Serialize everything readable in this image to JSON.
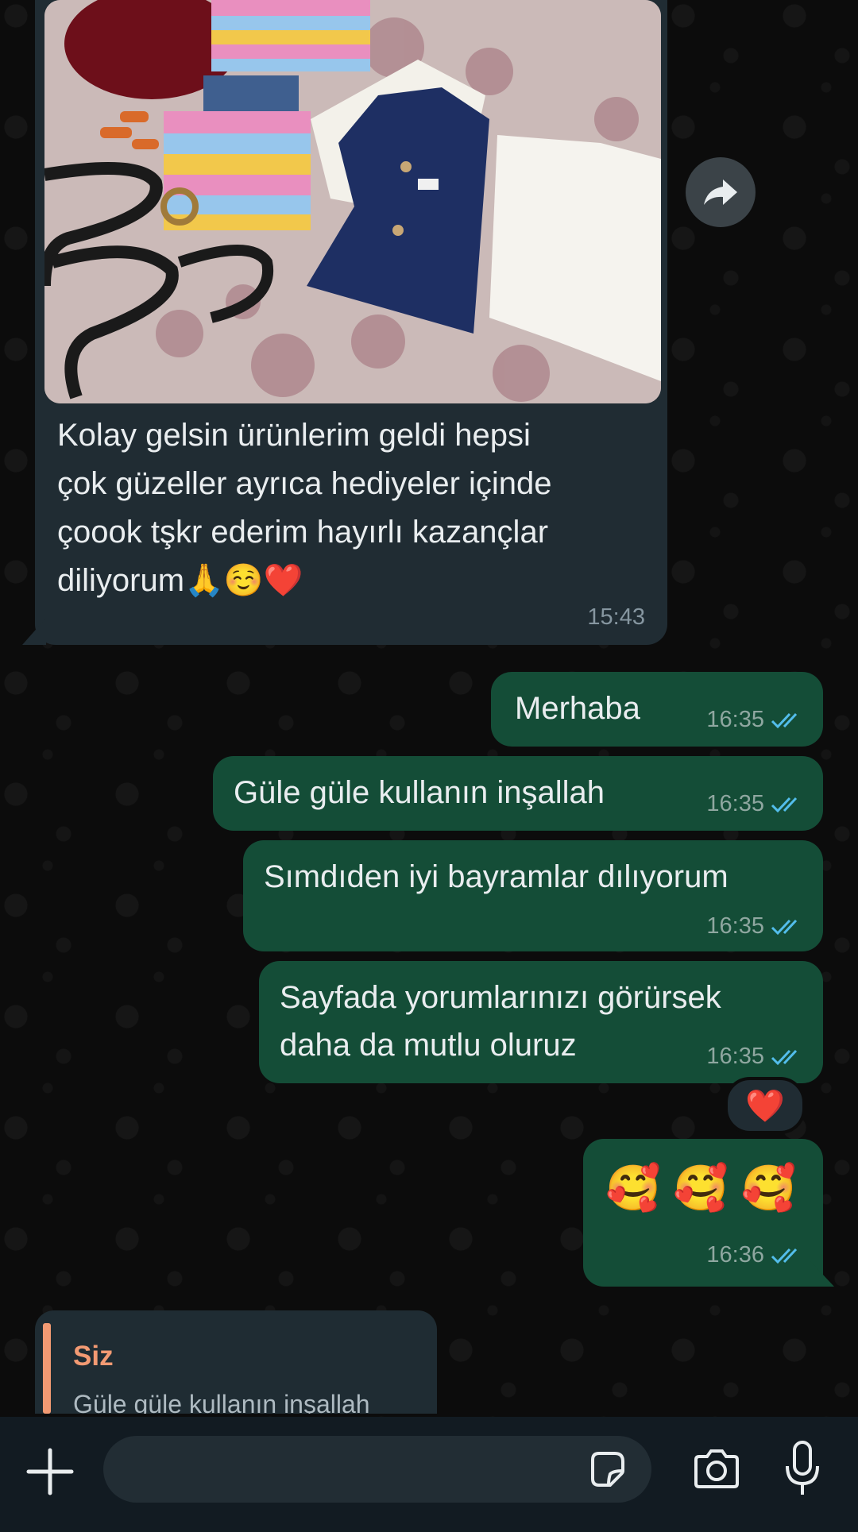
{
  "chat": {
    "incoming_media_message": {
      "image_description": "photo",
      "caption": "Kolay gelsin ürünlerim geldi hepsi çok güzeller ayrıca hediyeler içinde çoook tşkr ederim hayırlı kazançlar diliyorum🙏☺️❤️",
      "caption_lines": [
        "Kolay gelsin ürünlerim geldi hepsi",
        "çok güzeller ayrıca hediyeler içinde",
        "çoook tşkr ederim hayırlı kazançlar",
        "diliyorum🙏☺️❤️"
      ],
      "time": "15:43"
    },
    "outgoing_messages": [
      {
        "text": "Merhaba",
        "time": "16:35",
        "status": "read"
      },
      {
        "text": "Güle güle kullanın inşallah",
        "time": "16:35",
        "status": "read"
      },
      {
        "text": "Sımdıden iyi bayramlar dılıyorum",
        "time": "16:35",
        "status": "read"
      },
      {
        "text": "Sayfada yorumlarınızı görürsek daha da mutlu oluruz",
        "lines": [
          "Sayfada yorumlarınızı görürsek",
          "daha da mutlu oluruz"
        ],
        "time": "16:35",
        "status": "read",
        "reaction": "❤️"
      },
      {
        "text": "🥰 🥰 🥰",
        "time": "16:36",
        "status": "read"
      }
    ]
  },
  "reply_preview": {
    "sender": "Siz",
    "text": "Güle güle kullanın inşallah"
  },
  "composer": {
    "placeholder": "",
    "icons": [
      "plus-icon",
      "sticker-icon",
      "camera-icon",
      "microphone-icon"
    ]
  },
  "colors": {
    "background": "#0c0c0c",
    "incoming_bubble": "#202c33",
    "outgoing_bubble": "#144d37",
    "read_ticks": "#53bdeb",
    "reply_accent": "#f29a73"
  }
}
